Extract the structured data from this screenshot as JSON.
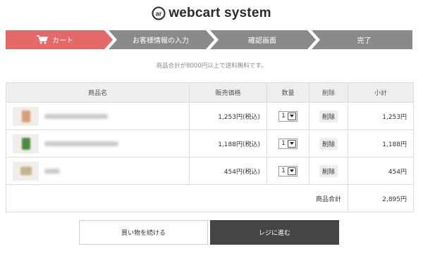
{
  "brand": {
    "name": "webcart system"
  },
  "steps": [
    {
      "label": "カート",
      "active": true
    },
    {
      "label": "お客様情報の入力",
      "active": false
    },
    {
      "label": "確認画面",
      "active": false
    },
    {
      "label": "完了",
      "active": false
    }
  ],
  "colors": {
    "active_step": "#e46a6a",
    "inactive_step": "#8a8a8a",
    "checkout_button": "#454545"
  },
  "notice": "商品合計が8000円以上で送料無料です。",
  "table": {
    "headers": {
      "name": "商品名",
      "price": "販売価格",
      "qty": "数量",
      "delete": "削除",
      "subtotal": "小計"
    },
    "rows": [
      {
        "price": "1,253円(税込)",
        "qty": "1",
        "delete": "削除",
        "subtotal": "1,253円"
      },
      {
        "price": "1,188円(税込)",
        "qty": "1",
        "delete": "削除",
        "subtotal": "1,188円"
      },
      {
        "price": "454円(税込)",
        "qty": "1",
        "delete": "削除",
        "subtotal": "454円"
      }
    ],
    "total_label": "商品合計",
    "total_value": "2,895円"
  },
  "buttons": {
    "continue": "買い物を続ける",
    "checkout": "レジに進む"
  }
}
